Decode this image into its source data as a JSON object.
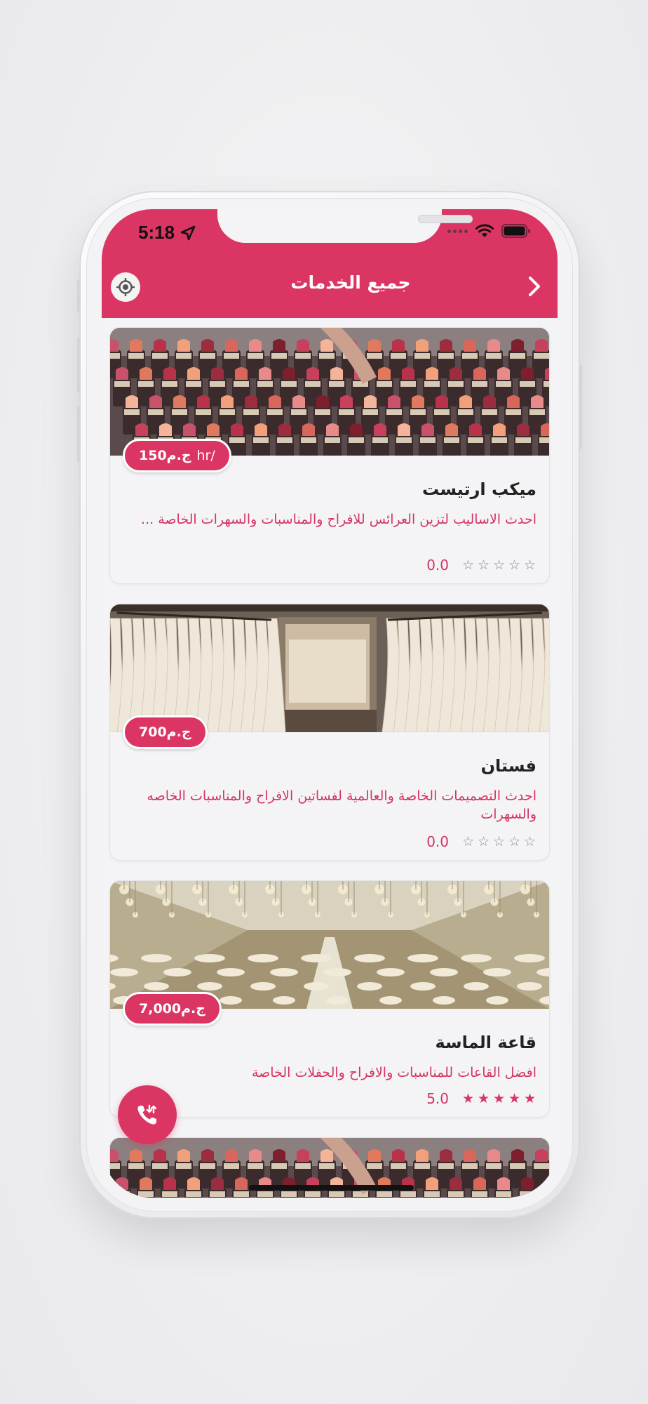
{
  "status_bar": {
    "time": "5:18"
  },
  "header": {
    "title": "جميع الخدمات"
  },
  "colors": {
    "accent": "#db3564",
    "text_dark": "#222222",
    "star_empty": "#8d8d8d"
  },
  "services": [
    {
      "name": "ميكب ارتيست",
      "price": "150ج.م",
      "unit": "hr/",
      "description": "احدث الاساليب لتزين العرائس  للافراح والمناسبات والسهرات الخاصة ...",
      "rating_text": "0.0",
      "stars": [
        0,
        0,
        0,
        0,
        0
      ],
      "image": "lipsticks"
    },
    {
      "name": "فستان",
      "price": "700ج.م",
      "unit": "",
      "description": "احدث التصميمات الخاصة والعالمية لفساتين الافراح والمناسبات الخاصه والسهرات",
      "rating_text": "0.0",
      "stars": [
        0,
        0,
        0,
        0,
        0
      ],
      "image": "dresses"
    },
    {
      "name": "قاعة الماسة",
      "price": "7,000ج.م",
      "unit": "",
      "description": "افضل القاعات للمناسبات والافراح والحفلات الخاصة",
      "rating_text": "5.0",
      "stars": [
        1,
        1,
        1,
        1,
        1
      ],
      "image": "hall"
    }
  ],
  "icons": {
    "back": "chevron-right-icon",
    "location": "crosshair-icon",
    "fab": "phone-icon"
  }
}
